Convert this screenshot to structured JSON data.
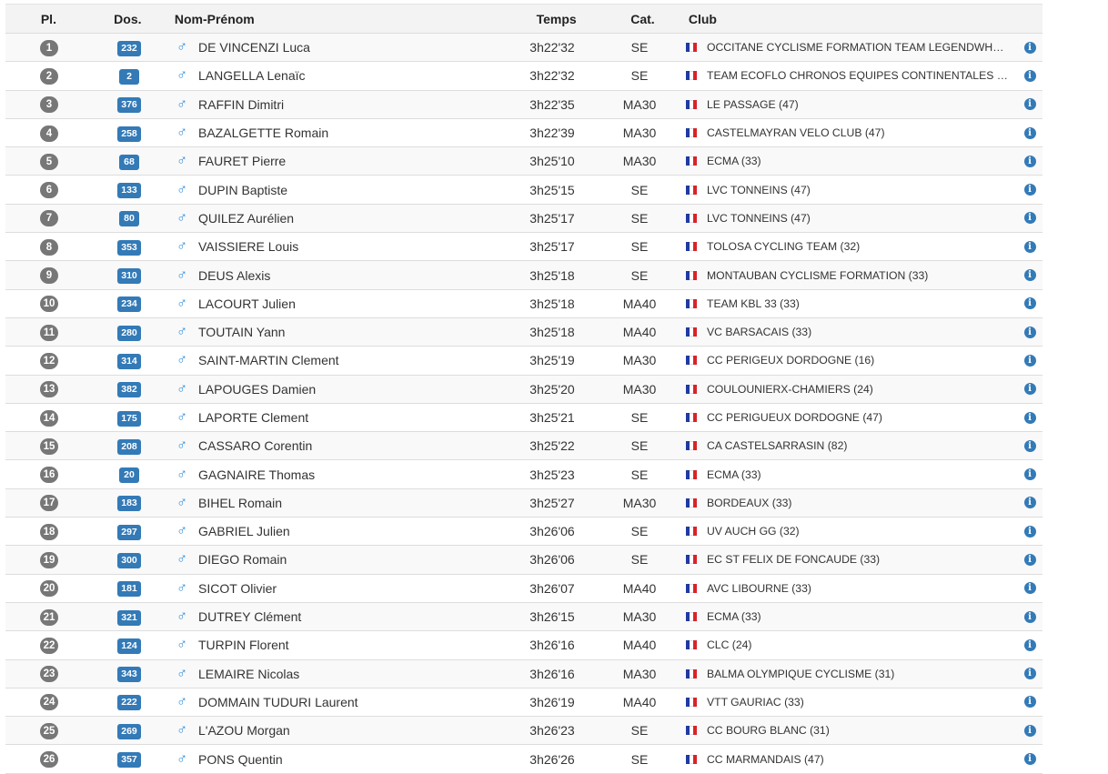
{
  "columns": {
    "pl": "Pl.",
    "dos": "Dos.",
    "name": "Nom-Prénom",
    "temps": "Temps",
    "cat": "Cat.",
    "club": "Club"
  },
  "gender_symbol": "♂",
  "info_symbol": "i",
  "rows": [
    {
      "pl": "1",
      "dos": "232",
      "name": "DE VINCENZI Luca",
      "temps": "3h22'32",
      "cat": "SE",
      "club": "OCCITANE CYCLISME FORMATION TEAM LEGENDWHE…"
    },
    {
      "pl": "2",
      "dos": "2",
      "name": "LANGELLA Lenaïc",
      "temps": "3h22'32",
      "cat": "SE",
      "club": "TEAM ECOFLO CHRONOS EQUIPES CONTINENTALES …"
    },
    {
      "pl": "3",
      "dos": "376",
      "name": "RAFFIN Dimitri",
      "temps": "3h22'35",
      "cat": "MA30",
      "club": "LE PASSAGE (47)"
    },
    {
      "pl": "4",
      "dos": "258",
      "name": "BAZALGETTE Romain",
      "temps": "3h22'39",
      "cat": "MA30",
      "club": "CASTELMAYRAN VELO CLUB (47)"
    },
    {
      "pl": "5",
      "dos": "68",
      "name": "FAURET Pierre",
      "temps": "3h25'10",
      "cat": "MA30",
      "club": "ECMA (33)"
    },
    {
      "pl": "6",
      "dos": "133",
      "name": "DUPIN Baptiste",
      "temps": "3h25'15",
      "cat": "SE",
      "club": "LVC TONNEINS (47)"
    },
    {
      "pl": "7",
      "dos": "80",
      "name": "QUILEZ Aurélien",
      "temps": "3h25'17",
      "cat": "SE",
      "club": "LVC TONNEINS (47)"
    },
    {
      "pl": "8",
      "dos": "353",
      "name": "VAISSIERE Louis",
      "temps": "3h25'17",
      "cat": "SE",
      "club": "TOLOSA CYCLING TEAM (32)"
    },
    {
      "pl": "9",
      "dos": "310",
      "name": "DEUS Alexis",
      "temps": "3h25'18",
      "cat": "SE",
      "club": "MONTAUBAN CYCLISME FORMATION (33)"
    },
    {
      "pl": "10",
      "dos": "234",
      "name": "LACOURT Julien",
      "temps": "3h25'18",
      "cat": "MA40",
      "club": "TEAM KBL 33 (33)"
    },
    {
      "pl": "11",
      "dos": "280",
      "name": "TOUTAIN Yann",
      "temps": "3h25'18",
      "cat": "MA40",
      "club": "VC BARSACAIS (33)"
    },
    {
      "pl": "12",
      "dos": "314",
      "name": "SAINT-MARTIN Clement",
      "temps": "3h25'19",
      "cat": "MA30",
      "club": "CC PERIGEUX DORDOGNE (16)"
    },
    {
      "pl": "13",
      "dos": "382",
      "name": "LAPOUGES Damien",
      "temps": "3h25'20",
      "cat": "MA30",
      "club": "COULOUNIERX-CHAMIERS (24)"
    },
    {
      "pl": "14",
      "dos": "175",
      "name": "LAPORTE Clement",
      "temps": "3h25'21",
      "cat": "SE",
      "club": "CC PERIGUEUX DORDOGNE (47)"
    },
    {
      "pl": "15",
      "dos": "208",
      "name": "CASSARO Corentin",
      "temps": "3h25'22",
      "cat": "SE",
      "club": "CA CASTELSARRASIN (82)"
    },
    {
      "pl": "16",
      "dos": "20",
      "name": "GAGNAIRE Thomas",
      "temps": "3h25'23",
      "cat": "SE",
      "club": "ECMA (33)"
    },
    {
      "pl": "17",
      "dos": "183",
      "name": "BIHEL Romain",
      "temps": "3h25'27",
      "cat": "MA30",
      "club": "BORDEAUX (33)"
    },
    {
      "pl": "18",
      "dos": "297",
      "name": "GABRIEL Julien",
      "temps": "3h26'06",
      "cat": "SE",
      "club": "UV AUCH GG (32)"
    },
    {
      "pl": "19",
      "dos": "300",
      "name": "DIEGO Romain",
      "temps": "3h26'06",
      "cat": "SE",
      "club": "EC ST FELIX DE FONCAUDE (33)"
    },
    {
      "pl": "20",
      "dos": "181",
      "name": "SICOT Olivier",
      "temps": "3h26'07",
      "cat": "MA40",
      "club": "AVC LIBOURNE (33)"
    },
    {
      "pl": "21",
      "dos": "321",
      "name": "DUTREY Clément",
      "temps": "3h26'15",
      "cat": "MA30",
      "club": "ECMA (33)"
    },
    {
      "pl": "22",
      "dos": "124",
      "name": "TURPIN Florent",
      "temps": "3h26'16",
      "cat": "MA40",
      "club": "CLC (24)"
    },
    {
      "pl": "23",
      "dos": "343",
      "name": "LEMAIRE Nicolas",
      "temps": "3h26'16",
      "cat": "MA30",
      "club": "BALMA OLYMPIQUE CYCLISME (31)"
    },
    {
      "pl": "24",
      "dos": "222",
      "name": "DOMMAIN TUDURI Laurent",
      "temps": "3h26'19",
      "cat": "MA40",
      "club": "VTT GAURIAC (33)"
    },
    {
      "pl": "25",
      "dos": "269",
      "name": "L'AZOU Morgan",
      "temps": "3h26'23",
      "cat": "SE",
      "club": "CC BOURG BLANC (31)"
    },
    {
      "pl": "26",
      "dos": "357",
      "name": "PONS Quentin",
      "temps": "3h26'26",
      "cat": "SE",
      "club": "CC MARMANDAIS (47)"
    }
  ]
}
